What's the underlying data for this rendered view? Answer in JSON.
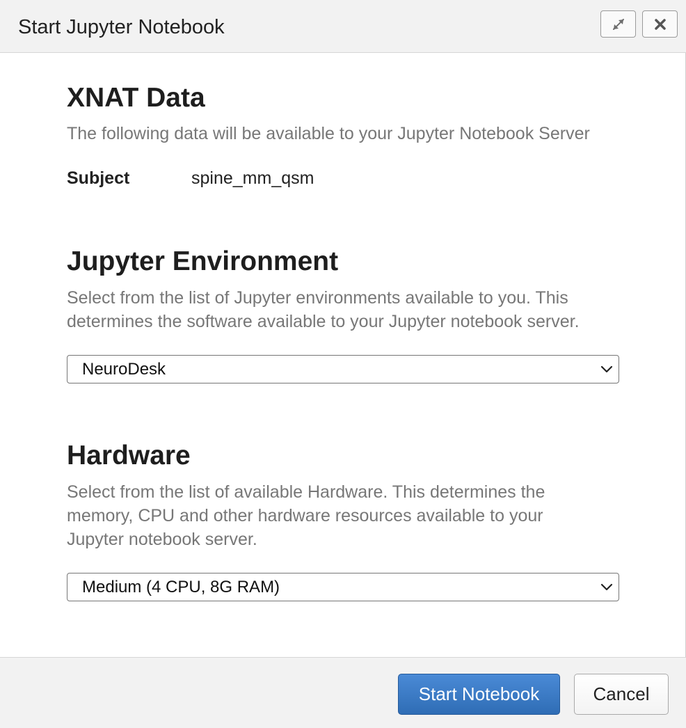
{
  "window": {
    "title": "Start Jupyter Notebook"
  },
  "xnat_data": {
    "heading": "XNAT Data",
    "description": "The following data will be available to your Jupyter Notebook Server",
    "subject_label": "Subject",
    "subject_value": "spine_mm_qsm"
  },
  "environment": {
    "heading": "Jupyter Environment",
    "description_line1": "Select from the list of Jupyter environments available to you. This",
    "description_line2": "determines the software available to your Jupyter notebook server.",
    "selected": "NeuroDesk"
  },
  "hardware": {
    "heading": "Hardware",
    "description_line1": "Select from the list of available Hardware. This determines the",
    "description_line2": "memory, CPU and other hardware resources available to your",
    "description_line3": "Jupyter notebook server.",
    "selected": "Medium (4 CPU, 8G RAM)"
  },
  "footer": {
    "start_label": "Start Notebook",
    "cancel_label": "Cancel"
  },
  "icons": {
    "maximize": "expand-arrows-icon",
    "close": "close-x-icon",
    "dropdown": "chevron-down-icon"
  },
  "colors": {
    "primary_button": "#3a7cc6",
    "titlebar_bg": "#f2f2f2",
    "description_text": "#777777"
  }
}
